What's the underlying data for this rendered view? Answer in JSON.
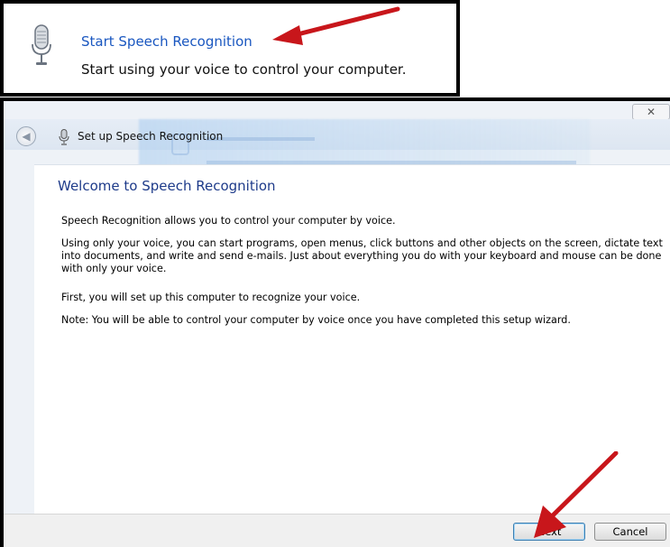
{
  "callout": {
    "title": "Start Speech Recognition",
    "description": "Start using your voice to control your computer."
  },
  "wizard": {
    "close_symbol": "✕",
    "title": "Set up Speech Recognition",
    "heading": "Welcome to Speech Recognition",
    "paragraphs": [
      "Speech Recognition allows you to control your computer by voice.",
      "Using only your voice, you can start programs, open menus, click buttons and other objects on the screen, dictate text into documents, and write and send e-mails. Just about everything you do with your keyboard and mouse can be done with only your voice.",
      "First, you will set up this computer to recognize your voice.",
      "Note: You will be able to control your computer by voice once you have completed this setup wizard."
    ],
    "buttons": {
      "next": "Next",
      "cancel": "Cancel"
    }
  },
  "icons": {
    "callout_icon": "microphone-icon",
    "title_icon": "microphone-icon",
    "back": "back-arrow-icon"
  },
  "colors": {
    "link_blue": "#1a57c0",
    "heading_blue": "#1e3b8a",
    "arrow_red": "#c8161b"
  }
}
